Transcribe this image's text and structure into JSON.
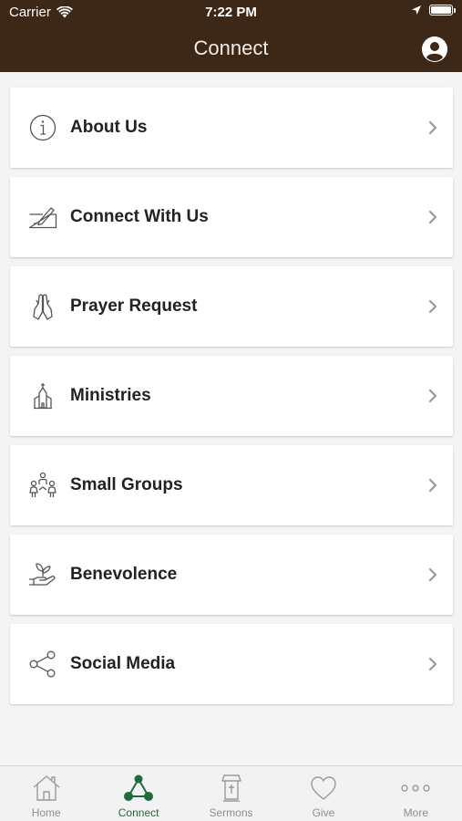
{
  "status_bar": {
    "carrier": "Carrier",
    "time": "7:22 PM"
  },
  "nav": {
    "title": "Connect",
    "profile_icon": "profile-icon"
  },
  "menu": {
    "items": [
      {
        "label": "About Us",
        "icon": "info-icon"
      },
      {
        "label": "Connect With Us",
        "icon": "signup-pencil-icon"
      },
      {
        "label": "Prayer Request",
        "icon": "praying-hands-icon"
      },
      {
        "label": "Ministries",
        "icon": "church-icon"
      },
      {
        "label": "Small Groups",
        "icon": "people-group-icon"
      },
      {
        "label": "Benevolence",
        "icon": "hand-plant-icon"
      },
      {
        "label": "Social Media",
        "icon": "share-icon"
      }
    ]
  },
  "tab_bar": {
    "tabs": [
      {
        "label": "Home",
        "icon": "home-icon",
        "active": false
      },
      {
        "label": "Connect",
        "icon": "connect-icon",
        "active": true
      },
      {
        "label": "Sermons",
        "icon": "pulpit-icon",
        "active": false
      },
      {
        "label": "Give",
        "icon": "heart-icon",
        "active": false
      },
      {
        "label": "More",
        "icon": "more-dots-icon",
        "active": false
      }
    ]
  },
  "colors": {
    "header_bg": "#3d2818",
    "active_tab": "#1f6b3c",
    "inactive_tab": "#8e8e93",
    "page_bg": "#f4f4f4"
  }
}
